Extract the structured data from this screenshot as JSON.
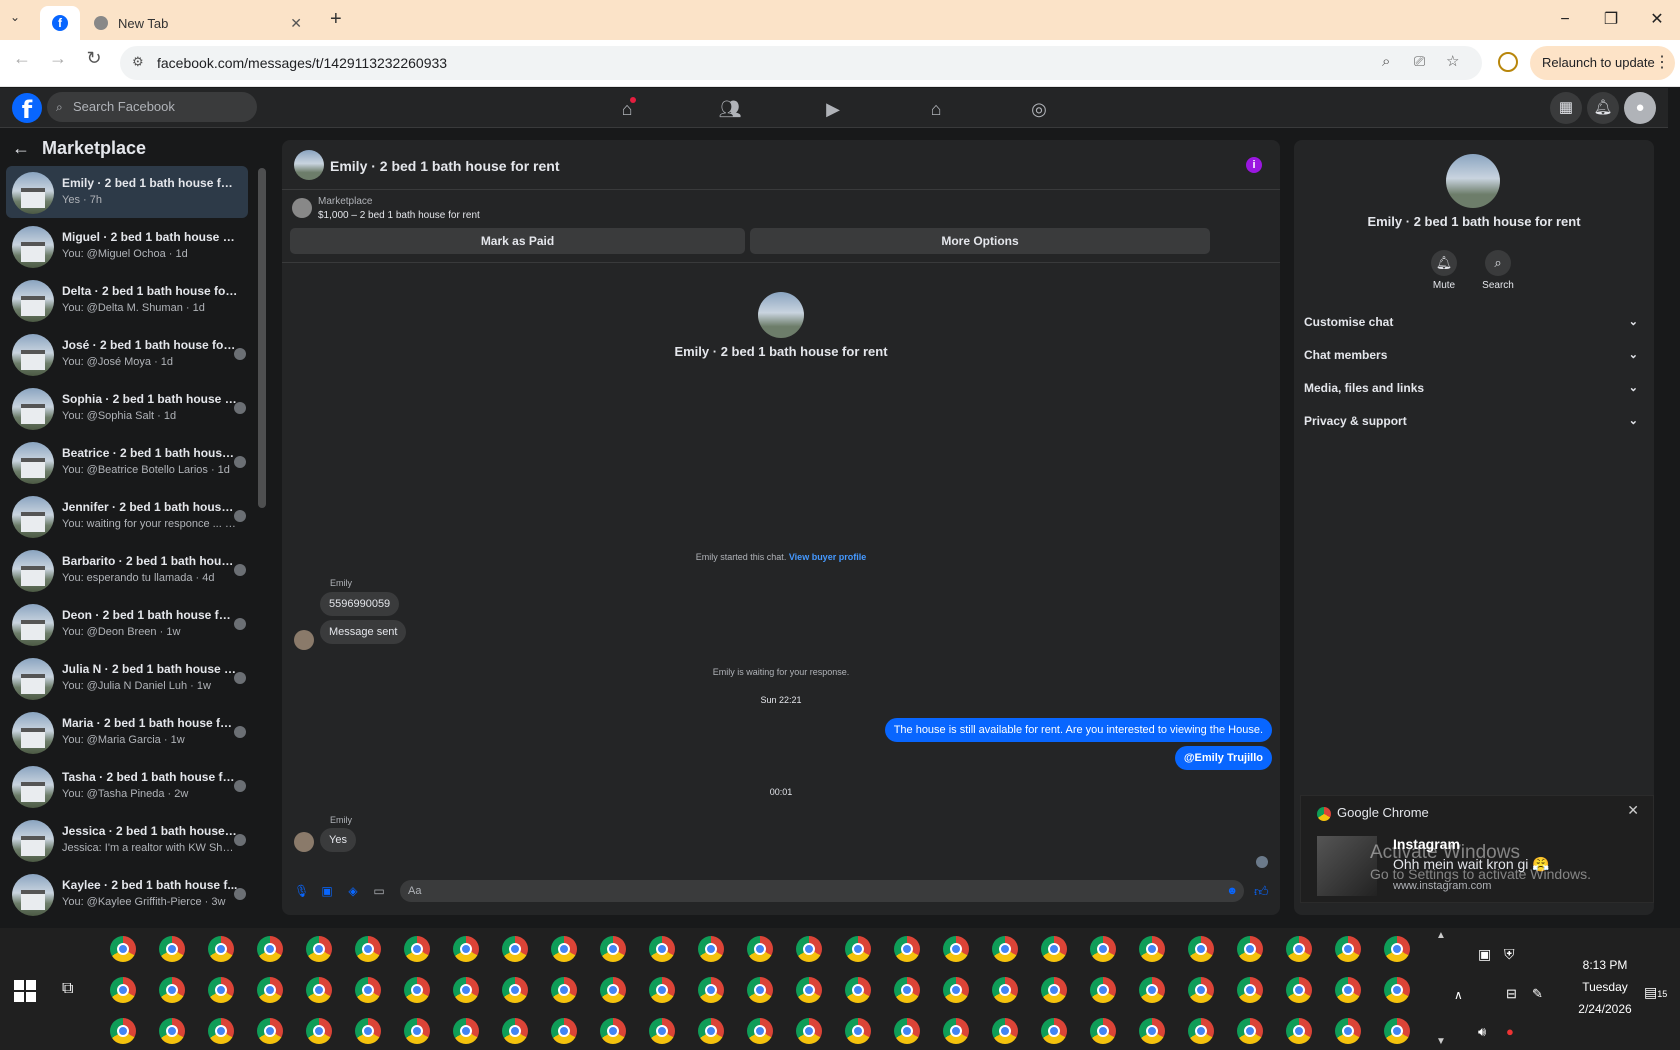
{
  "browser": {
    "tab_title": "New Tab",
    "url": "facebook.com/messages/t/1429113232260933",
    "relaunch_label": "Relaunch to update"
  },
  "fb_nav": {
    "search_placeholder": "Search Facebook"
  },
  "left_panel": {
    "title": "Marketplace",
    "conversations": [
      {
        "name": "Emily · 2 bed 1 bath house for r...",
        "sub": "Yes · 7h",
        "active": true
      },
      {
        "name": "Miguel · 2 bed 1 bath house for...",
        "sub": "You: @Miguel Ochoa · 1d"
      },
      {
        "name": "Delta · 2 bed 1 bath house for r...",
        "sub": "You: @Delta M. Shuman · 1d"
      },
      {
        "name": "José · 2 bed 1 bath house for ...",
        "sub": "You: @José Moya · 1d"
      },
      {
        "name": "Sophia · 2 bed 1 bath house f...",
        "sub": "You: @Sophia Salt · 1d"
      },
      {
        "name": "Beatrice · 2 bed 1 bath house ...",
        "sub": "You: @Beatrice Botello Larios · 1d"
      },
      {
        "name": "Jennifer · 2 bed 1 bath house ...",
        "sub": "You: waiting for your responce ... · 1d"
      },
      {
        "name": "Barbarito · 2 bed 1 bath hous...",
        "sub": "You: esperando tu llamada · 4d"
      },
      {
        "name": "Deon · 2 bed 1 bath house for r...",
        "sub": "You: @Deon Breen · 1w"
      },
      {
        "name": "Julia N · 2 bed 1 bath house f...",
        "sub": "You: @Julia N Daniel Luh · 1w"
      },
      {
        "name": "Maria · 2 bed 1 bath house for r...",
        "sub": "You: @Maria Garcia · 1w"
      },
      {
        "name": "Tasha · 2 bed 1 bath house for r...",
        "sub": "You: @Tasha Pineda · 2w"
      },
      {
        "name": "Jessica · 2 bed 1 bath house for ...",
        "sub": "Jessica: I'm a realtor with KW Sho... · 3w"
      },
      {
        "name": "Kaylee · 2 bed 1 bath house f...",
        "sub": "You: @Kaylee Griffith-Pierce · 3w"
      }
    ]
  },
  "chat": {
    "title": "Emily · 2 bed 1 bath house for rent",
    "marketplace_label": "Marketplace",
    "listing": "$1,000 – 2 bed 1 bath house for rent",
    "mark_paid": "Mark as Paid",
    "more_options": "More Options",
    "center_name": "Emily · 2 bed 1 bath house for rent",
    "started_text": "Emily started this chat.",
    "view_buyer": "View buyer profile",
    "sender1": "Emily",
    "msg1": "5596990059",
    "msg2": "Message sent",
    "waiting": "Emily is waiting for your response.",
    "time1": "Sun 22:21",
    "out1": "The house is still available for rent. Are you interested to viewing  the House.",
    "out2": "@Emily Trujillo",
    "time2": "00:01",
    "sender2": "Emily",
    "msg3": "Yes",
    "composer_placeholder": "Aa"
  },
  "right_panel": {
    "name": "Emily · 2 bed 1 bath house for rent",
    "mute": "Mute",
    "search": "Search",
    "rows": [
      "Customise chat",
      "Chat members",
      "Media, files and links",
      "Privacy & support"
    ]
  },
  "notification": {
    "app": "Google Chrome",
    "title": "Instagram",
    "body": "Ohh mein wait kron gi 😤",
    "url": "www.instagram.com"
  },
  "watermark": {
    "line1": "Activate Windows",
    "line2": "Go to Settings to activate Windows."
  },
  "taskbar": {
    "time": "8:13 PM",
    "day": "Tuesday",
    "date": "2/24/2026",
    "notif_count": "15"
  },
  "colors": {
    "fb_blue": "#0866ff",
    "bg_dark": "#18191a",
    "panel": "#242526",
    "info_purple": "#9a17e0"
  }
}
